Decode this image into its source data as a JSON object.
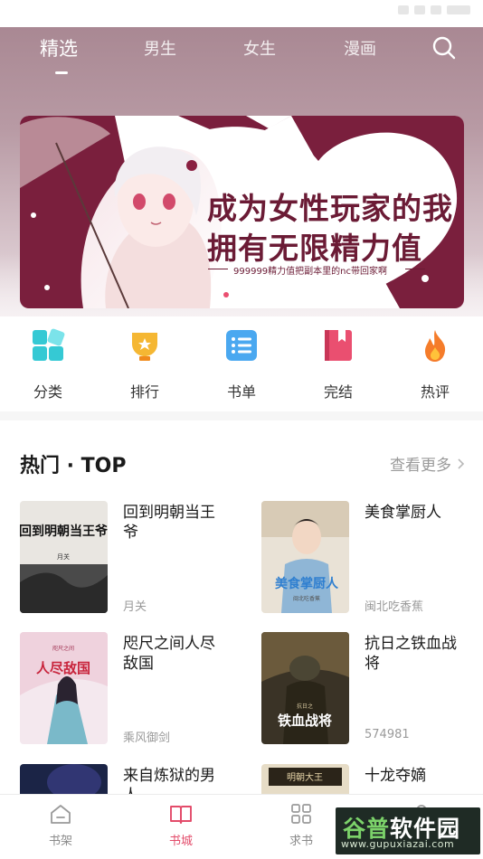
{
  "top_nav": {
    "tabs": [
      {
        "label": "精选",
        "active": true
      },
      {
        "label": "男生",
        "active": false
      },
      {
        "label": "女生",
        "active": false
      },
      {
        "label": "漫画",
        "active": false
      }
    ],
    "search_icon": "search-icon"
  },
  "banner": {
    "line1": "成为女性玩家的我",
    "line2": "拥有无限精力值",
    "subtitle": "999999精力值把副本里的nc带回家啊",
    "slide_count": 2,
    "active_slide": 1,
    "accent_color": "#6b1b35"
  },
  "categories": [
    {
      "label": "分类",
      "icon": "grid-icon",
      "color": "#35c9d4"
    },
    {
      "label": "排行",
      "icon": "trophy-icon",
      "color": "#f5b733"
    },
    {
      "label": "书单",
      "icon": "list-icon",
      "color": "#4aa8f0"
    },
    {
      "label": "完结",
      "icon": "book-icon",
      "color": "#ea4f70"
    },
    {
      "label": "热评",
      "icon": "flame-icon",
      "color": "#f57c2a"
    }
  ],
  "hot_section": {
    "title": "热门 · TOP",
    "more_label": "查看更多"
  },
  "books": [
    {
      "title": "回到明朝当王爷",
      "author": "月关",
      "cover_text": "回到明朝当王爷",
      "cover_author": "月关"
    },
    {
      "title": "美食掌厨人",
      "author": "闽北吃香蕉",
      "cover_text": "美食掌厨人",
      "cover_author": "闽北吃香蕉"
    },
    {
      "title": "咫尺之间人尽敌国",
      "author": "乘风御剑",
      "cover_text": "人尽敌国",
      "cover_author": "咫尺之间"
    },
    {
      "title": "抗日之铁血战将",
      "author": "574981",
      "cover_text": "铁血战将",
      "cover_author": "抗日之"
    },
    {
      "title": "来自炼狱的男人",
      "author": "",
      "cover_text": "",
      "cover_author": ""
    },
    {
      "title": "十龙夺嫡",
      "author": "",
      "cover_text": "明朝大王",
      "cover_author": ""
    }
  ],
  "bottom_nav": [
    {
      "label": "书架",
      "icon": "bookshelf-icon",
      "active": false
    },
    {
      "label": "书城",
      "icon": "bookstore-icon",
      "active": true
    },
    {
      "label": "求书",
      "icon": "request-icon",
      "active": false
    },
    {
      "label": "",
      "icon": "profile-icon",
      "active": false
    }
  ],
  "watermark": {
    "main_a": "谷普",
    "main_b": "软件园",
    "url": "www.gupuxiazai.com"
  },
  "colors": {
    "accent": "#e34b6a",
    "hero_top": "#a98893"
  }
}
